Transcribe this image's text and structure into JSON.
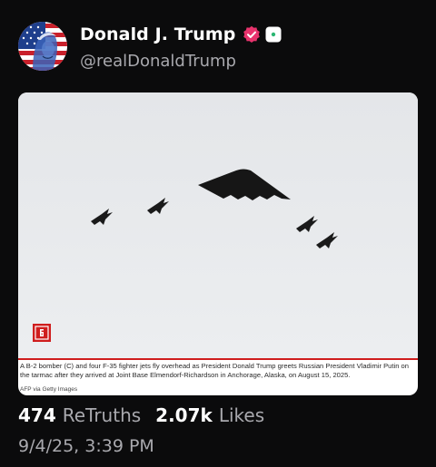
{
  "profile": {
    "display_name": "Donald J. Trump",
    "handle": "@realDonaldTrump"
  },
  "media": {
    "caption": "A B-2 bomber (C) and four F-35 fighter jets fly overhead as President Donald Trump greets Russian President Vladimir Putin on the tarmac after they arrived at Joint Base Elmendorf-Richardson in Anchorage, Alaska, on August 15, 2025.",
    "credit": "AFP via Getty Images"
  },
  "stats": {
    "retruths_count": "474",
    "retruths_label": "ReTruths",
    "likes_count": "2.07k",
    "likes_label": "Likes"
  },
  "timestamp": "9/4/25, 3:39 PM",
  "colors": {
    "background": "#0b0b0c",
    "verified_badge": "#e8336d",
    "muted_text": "#a9a9ae",
    "accent_red": "#cf1d1d"
  }
}
